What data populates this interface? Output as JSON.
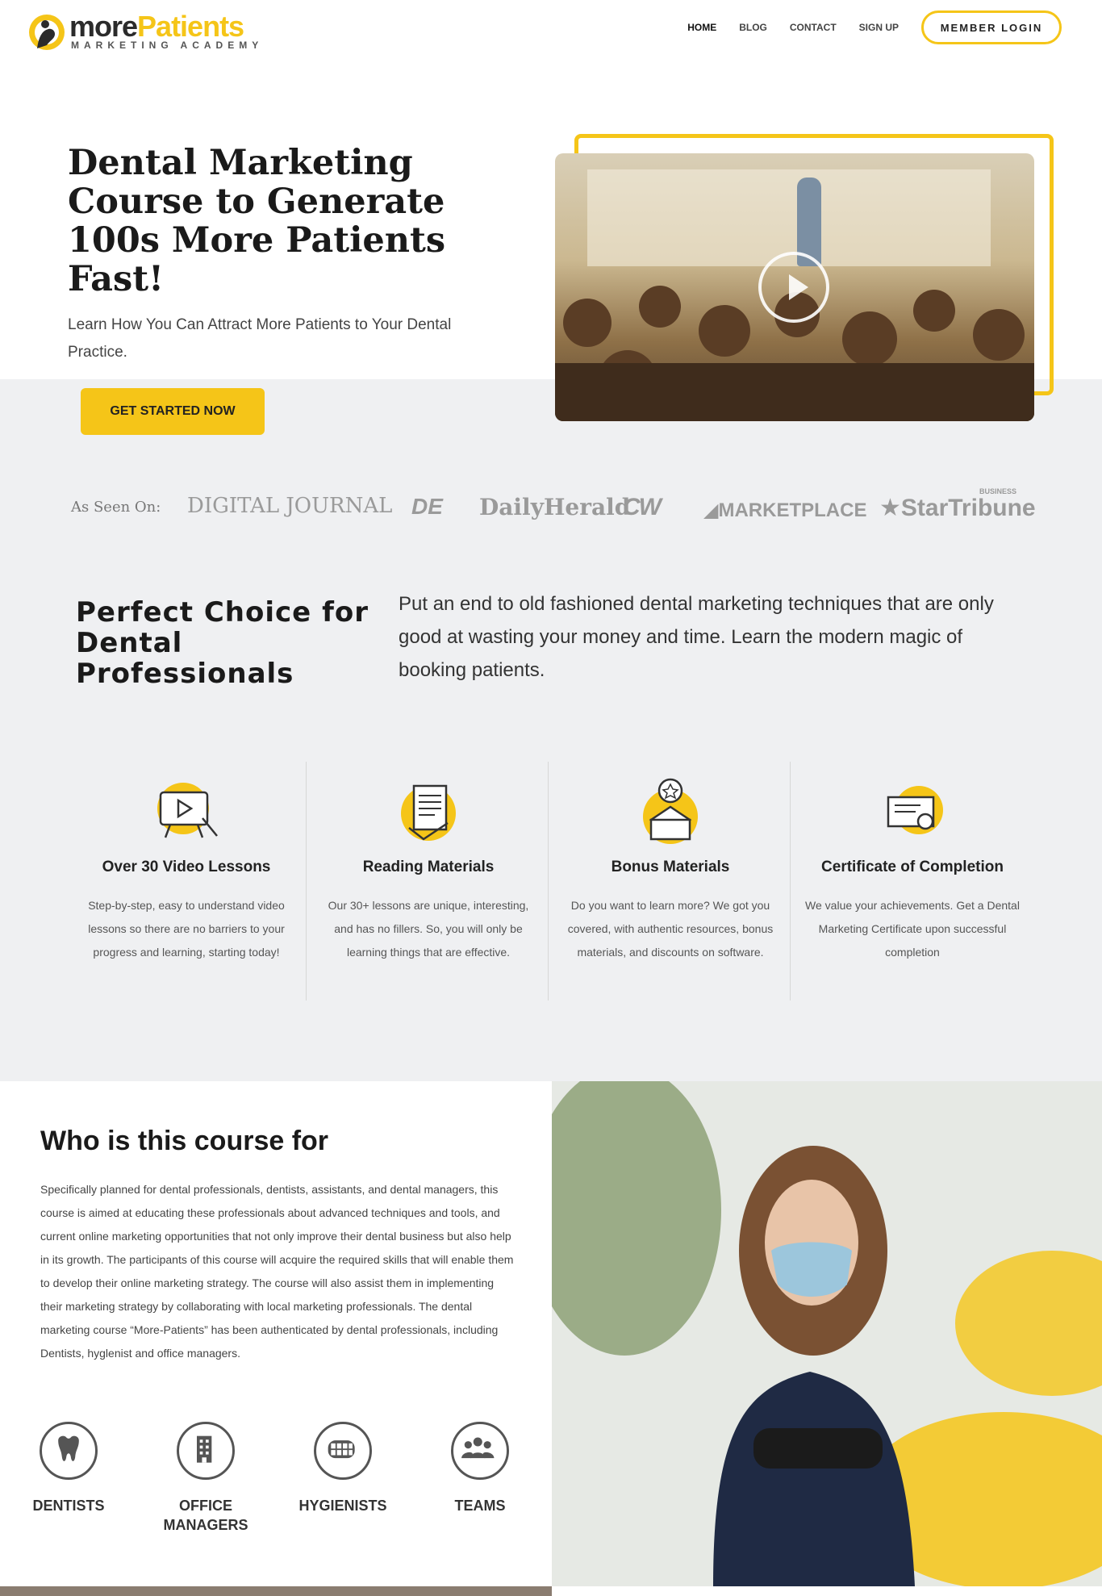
{
  "brand": {
    "name_prefix": "more",
    "name_suffix": "Patients",
    "tagline": "MARKETING ACADEMY",
    "accent_color": "#f5c518"
  },
  "nav": {
    "items": [
      {
        "label": "HOME",
        "active": true
      },
      {
        "label": "BLOG",
        "active": false
      },
      {
        "label": "CONTACT",
        "active": false
      },
      {
        "label": "SIGN UP",
        "active": false
      }
    ],
    "member_login": "MEMBER LOGIN"
  },
  "hero": {
    "title": "Dental Marketing Course to Generate 100s More Patients Fast!",
    "subtitle": "Learn How You Can Attract More Patients to Your Dental Practice.",
    "cta_label": "GET STARTED NOW",
    "video_icon": "play-icon"
  },
  "as_seen_on": {
    "label": "As Seen On:",
    "logos": [
      {
        "name": "DIGITAL JOURNAL"
      },
      {
        "name": "DE"
      },
      {
        "name": "DailyHerald"
      },
      {
        "name": "CW"
      },
      {
        "name": "MARKETPLACE"
      },
      {
        "name": "StarTribune"
      }
    ],
    "startribune_badge": "BUSINESS"
  },
  "perfect_choice": {
    "title": "Perfect Choice for Dental Professionals",
    "text": "Put an end to old fashioned dental marketing techniques that are only good at wasting your money and time. Learn the modern magic of booking patients."
  },
  "features": [
    {
      "icon": "video-lesson-icon",
      "title": "Over 30 Video Lessons",
      "text": "Step-by-step, easy to understand video lessons so there are no barriers to your progress and learning, starting today!"
    },
    {
      "icon": "document-icon",
      "title": "Reading Materials",
      "text": "Our 30+ lessons are unique, interesting, and has no fillers. So, you will only be learning things that are effective."
    },
    {
      "icon": "award-box-icon",
      "title": "Bonus Materials",
      "text": "Do you want to learn more? We got you covered, with authentic resources, bonus materials, and discounts on software."
    },
    {
      "icon": "certificate-icon",
      "title": "Certificate of Completion",
      "text": "We value your achievements. Get a Dental Marketing Certificate upon successful completion"
    }
  ],
  "who": {
    "title": "Who is this course for",
    "text": "Specifically planned for dental professionals, dentists, assistants, and dental managers, this course is aimed at educating these professionals about advanced techniques and tools, and current online marketing opportunities that not only improve their dental business but also help in its growth. The participants of this course will acquire the required skills that will enable them to develop their online marketing strategy. The course will also assist them in implementing their marketing strategy by collaborating with local marketing professionals. The dental marketing course “More-Patients” has been authenticated by dental professionals, including Dentists, hyglenist and office managers.",
    "roles": [
      {
        "icon": "tooth-icon",
        "label": "DENTISTS"
      },
      {
        "icon": "building-icon",
        "label": "OFFICE MANAGERS"
      },
      {
        "icon": "teeth-icon",
        "label": "HYGIENISTS"
      },
      {
        "icon": "team-icon",
        "label": "TEAMS"
      }
    ]
  }
}
